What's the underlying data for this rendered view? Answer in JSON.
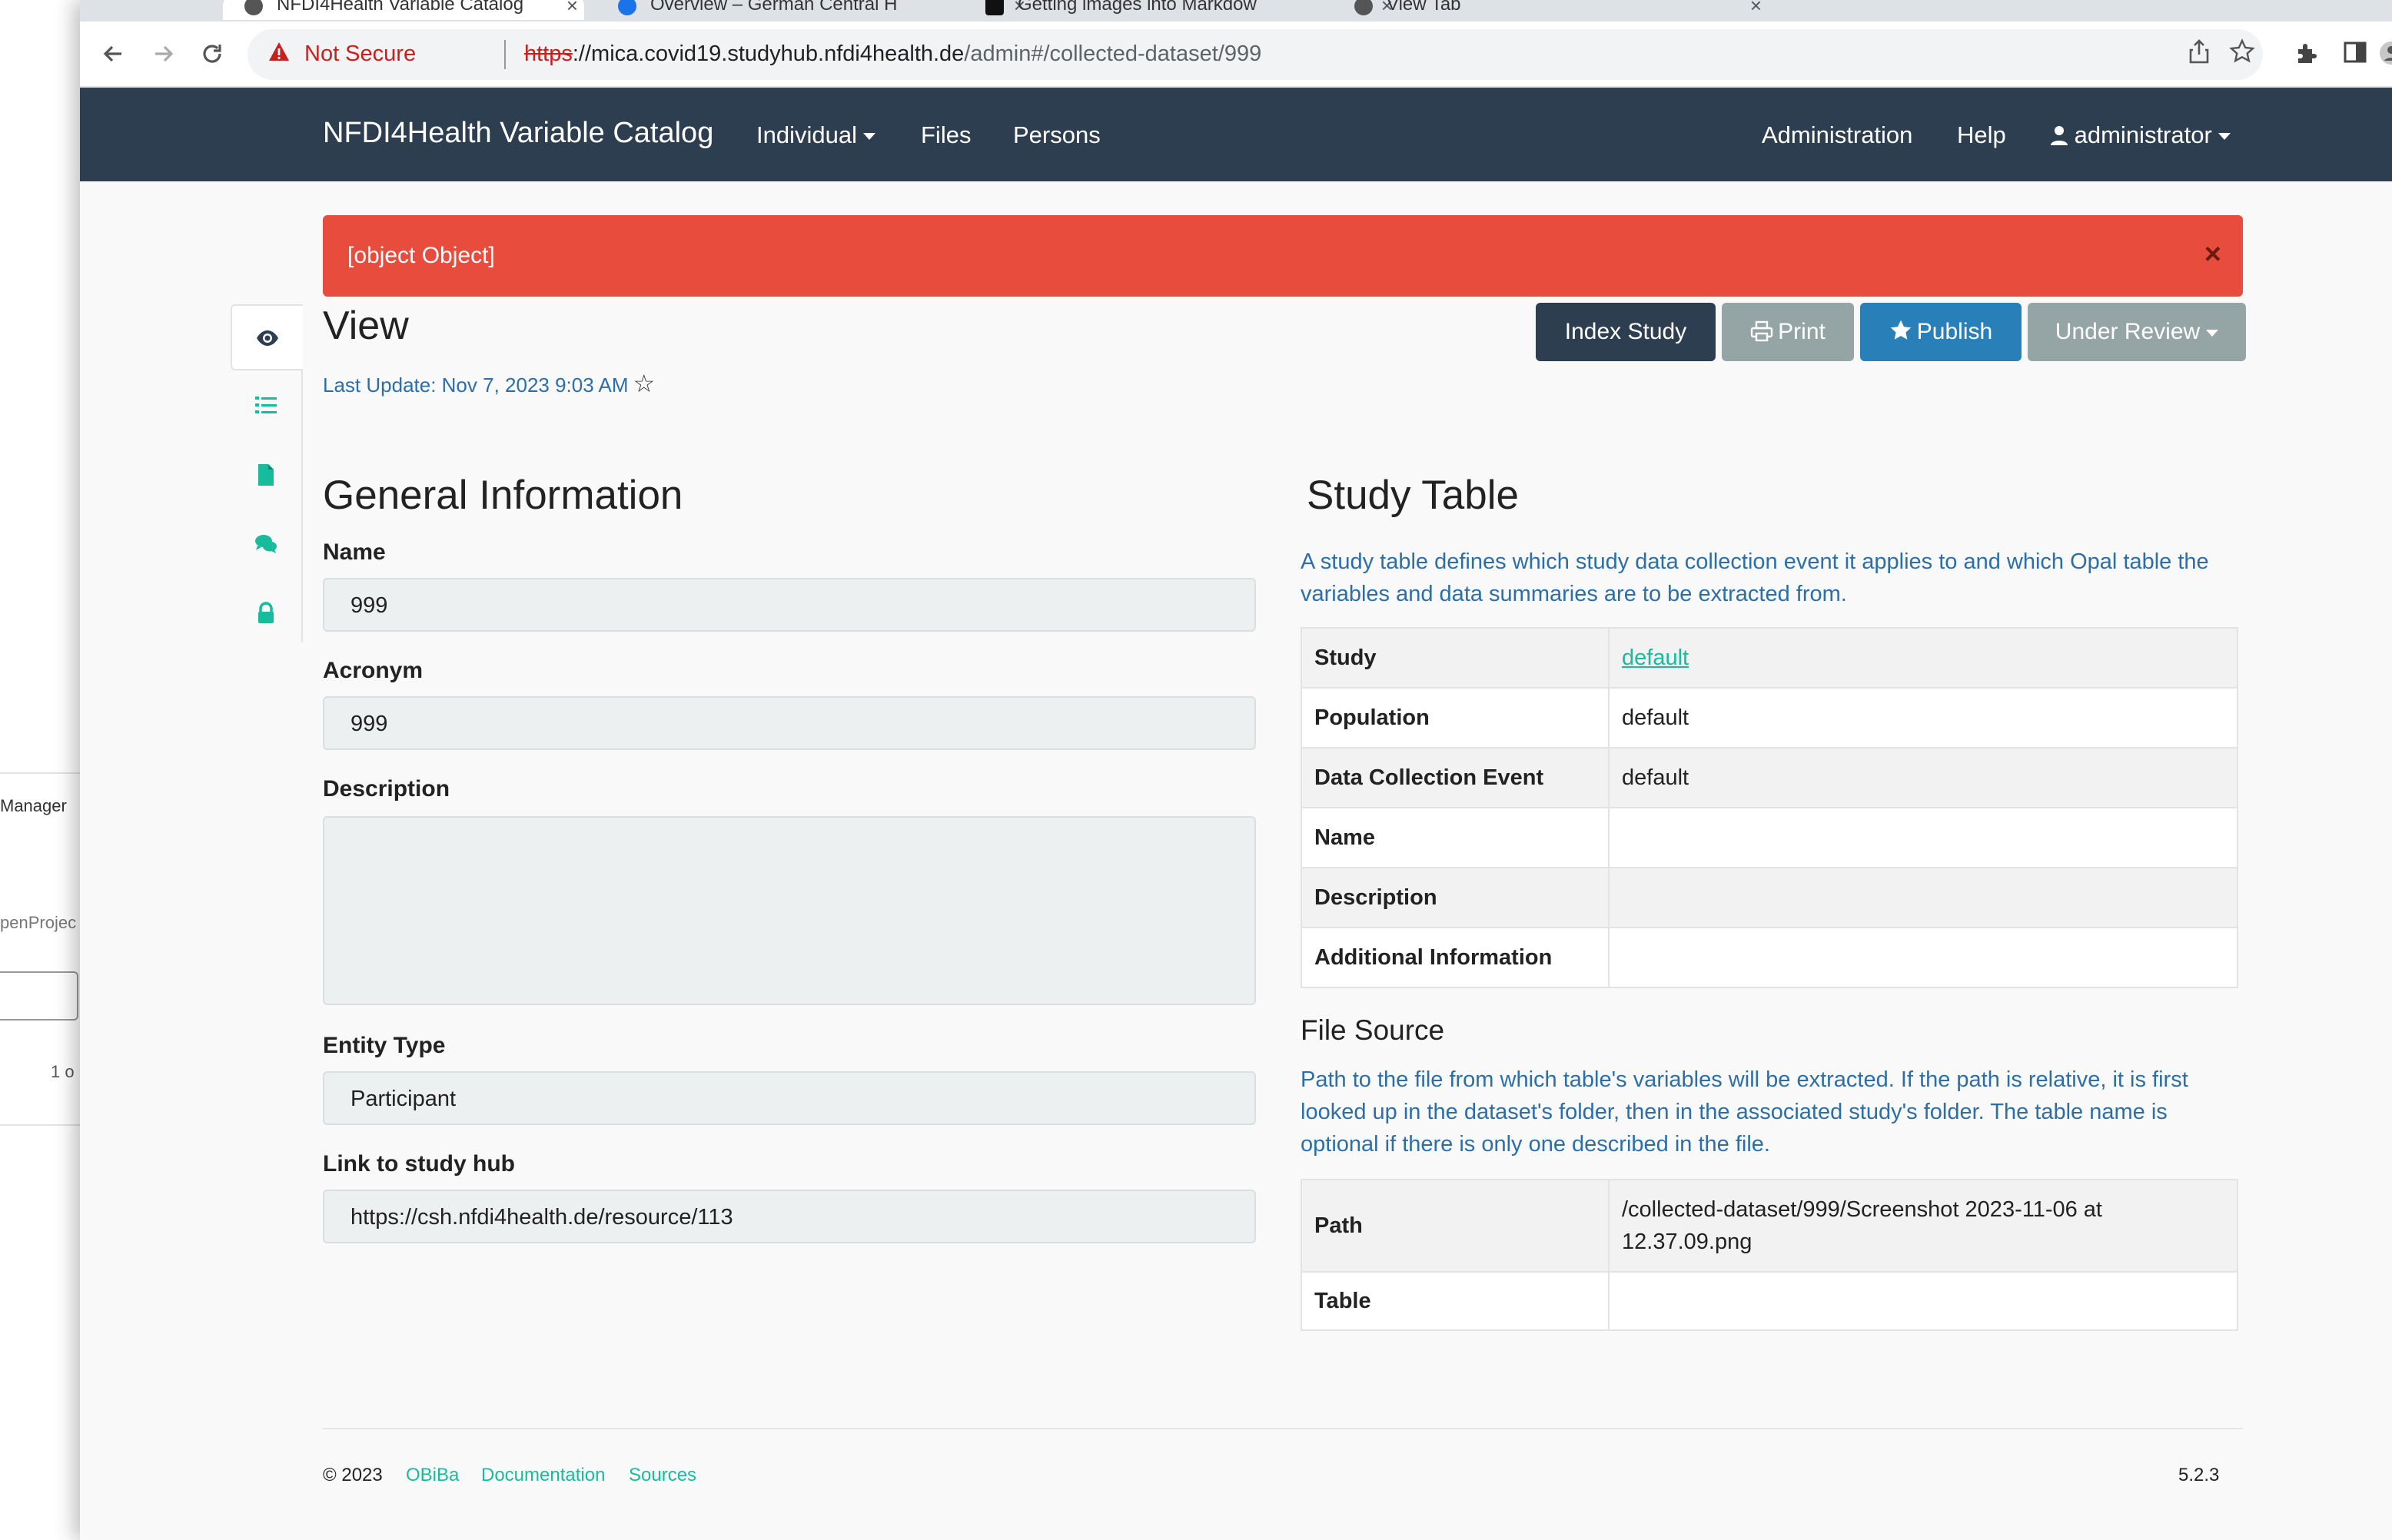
{
  "background_app": {
    "label_manager": "Manager",
    "label_project": "penProjec",
    "label_page": "1 o"
  },
  "browser": {
    "tabs": [
      {
        "title": "NFDI4Health Variable Catalog"
      },
      {
        "title": "Overview – German Central H"
      },
      {
        "title": "Getting images into Markdow"
      },
      {
        "title": "View Tab"
      }
    ],
    "security_label": "Not Secure",
    "url_scheme": "https",
    "url_host": "://mica.covid19.studyhub.nfdi4health.de",
    "url_path": "/admin#/collected-dataset/999",
    "icons": [
      "back-arrow-icon",
      "forward-arrow-icon",
      "reload-icon",
      "warning-icon",
      "share-icon",
      "bookmark-star-icon",
      "extensions-icon",
      "sidebar-icon",
      "profile-icon"
    ]
  },
  "navbar": {
    "brand": "NFDI4Health Variable Catalog",
    "items": [
      {
        "label": "Individual"
      },
      {
        "label": "Files"
      },
      {
        "label": "Persons"
      }
    ],
    "right_items": [
      {
        "label": "Administration"
      },
      {
        "label": "Help"
      },
      {
        "label": "administrator"
      }
    ]
  },
  "alert": {
    "message": "[object Object]",
    "close": "×",
    "color": "#e74c3c"
  },
  "page": {
    "title": "View",
    "last_update": "Last Update: Nov 7, 2023 9:03 AM",
    "actions": {
      "index": "Index Study",
      "print": "Print",
      "publish": "Publish",
      "review": "Under Review"
    }
  },
  "general": {
    "heading": "General Information",
    "fields": {
      "name_label": "Name",
      "name_value": "999",
      "acronym_label": "Acronym",
      "acronym_value": "999",
      "description_label": "Description",
      "description_value": "",
      "entity_label": "Entity Type",
      "entity_value": "Participant",
      "link_label": "Link to study hub",
      "link_value": "https://csh.nfdi4health.de/resource/113"
    }
  },
  "study_table": {
    "heading": "Study Table",
    "description": "A study table defines which study data collection event it applies to and which Opal table the variables and data summaries are to be extracted from.",
    "rows": [
      {
        "key": "Study",
        "value": "default"
      },
      {
        "key": "Population",
        "value": "default"
      },
      {
        "key": "Data Collection Event",
        "value": "default"
      },
      {
        "key": "Name",
        "value": ""
      },
      {
        "key": "Description",
        "value": ""
      },
      {
        "key": "Additional Information",
        "value": ""
      }
    ]
  },
  "file_source": {
    "heading": "File Source",
    "description": "Path to the file from which table's variables will be extracted. If the path is relative, it is first looked up in the dataset's folder, then in the associated study's folder. The table name is optional if there is only one described in the file.",
    "rows": [
      {
        "key": "Path",
        "value": "/collected-dataset/999/Screenshot 2023-11-06 at 12.37.09.png"
      },
      {
        "key": "Table",
        "value": ""
      }
    ]
  },
  "footer": {
    "copyright": "© 2023",
    "links": [
      "OBiBa",
      "Documentation",
      "Sources"
    ],
    "version": "5.2.3"
  },
  "colors": {
    "navbar": "#2c3e50",
    "link": "#18bc9c",
    "info_text": "#2c6fa8",
    "publish": "#2980b9",
    "muted_button": "#95a5a6"
  }
}
